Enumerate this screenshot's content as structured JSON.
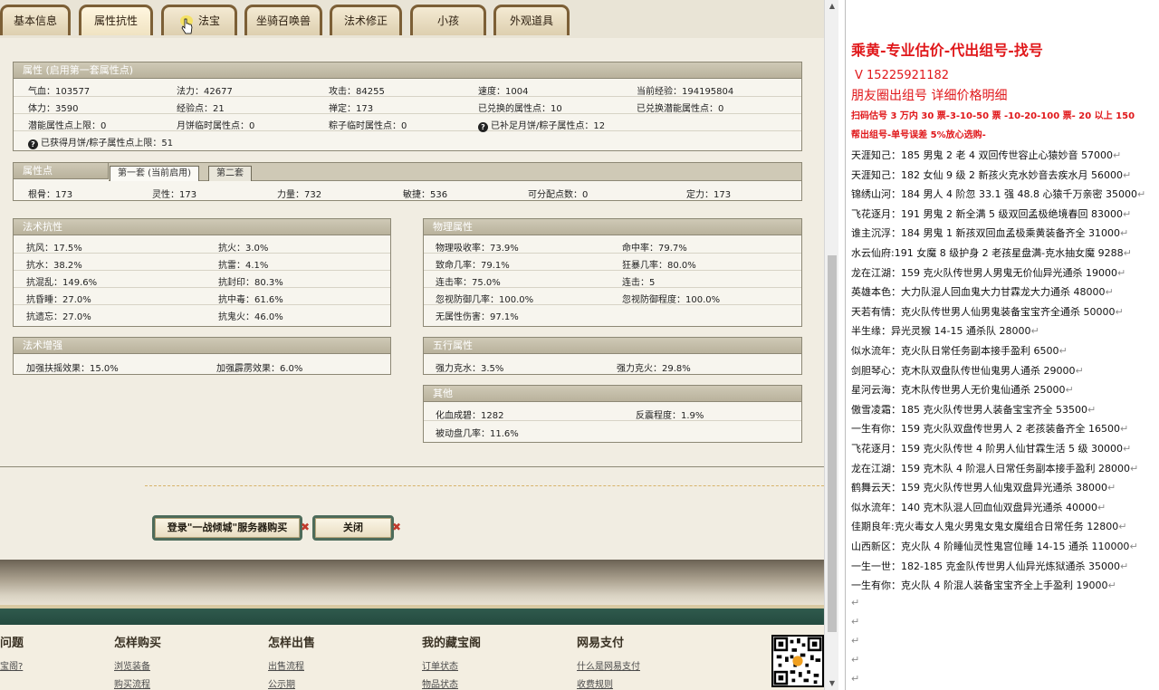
{
  "tabs": [
    "基本信息",
    "属性抗性",
    "法宝",
    "坐骑召唤兽",
    "法术修正",
    "小孩",
    "外观道具"
  ],
  "attr_panel": {
    "title": "属性 (启用第一套属性点)",
    "rows": [
      [
        "气血：103577",
        "法力：42677",
        "攻击：84255",
        "速度：1004",
        "当前经验：194195804"
      ],
      [
        "体力：3590",
        "经验点：21",
        "禅定：173",
        "已兑换的属性点：10",
        "已兑换潜能属性点：0"
      ],
      [
        "潜能属性点上限：0",
        "月饼临时属性点：0",
        "粽子临时属性点：0",
        "已补足月饼/粽子属性点：12",
        ""
      ]
    ],
    "extra": "已获得月饼/粽子属性点上限：51"
  },
  "points_panel": {
    "title": "属性点",
    "subtabs": [
      "第一套 (当前启用)",
      "第二套"
    ],
    "values": [
      "根骨：173",
      "灵性：173",
      "力量：732",
      "敏捷：536",
      "可分配点数：0",
      "定力：173"
    ]
  },
  "resist_panel": {
    "title": "法术抗性",
    "rows": [
      [
        "抗风：17.5%",
        "抗火：3.0%"
      ],
      [
        "抗水：38.2%",
        "抗雷：4.1%"
      ],
      [
        "抗混乱：149.6%",
        "抗封印：80.3%"
      ],
      [
        "抗昏睡：27.0%",
        "抗中毒：61.6%"
      ],
      [
        "抗遗忘：27.0%",
        "抗鬼火：46.0%"
      ]
    ]
  },
  "physical_panel": {
    "title": "物理属性",
    "rows": [
      [
        "物理吸收率：73.9%",
        "命中率：79.7%"
      ],
      [
        "致命几率：79.1%",
        "狂暴几率：80.0%"
      ],
      [
        "连击率：75.0%",
        "连击：5"
      ],
      [
        "忽视防御几率：100.0%",
        "忽视防御程度：100.0%"
      ],
      [
        "无属性伤害：97.1%",
        ""
      ]
    ]
  },
  "boost_panel": {
    "title": "法术增强",
    "row": [
      "加强扶摇效果：15.0%",
      "加强霹雳效果：6.0%"
    ]
  },
  "five_panel": {
    "title": "五行属性",
    "row": [
      "强力克水：3.5%",
      "强力克火：29.8%"
    ]
  },
  "other_panel": {
    "title": "其他",
    "rows": [
      [
        "化血成碧：1282",
        "反震程度：1.9%"
      ],
      [
        "被动盘几率：11.6%",
        ""
      ]
    ]
  },
  "buttons": {
    "login": "登录\"一战倾城\"服务器购买",
    "close": "关闭",
    "x": "✖"
  },
  "footer": {
    "cols": [
      {
        "title": "问题",
        "links": [
          "宝阁?",
          ""
        ]
      },
      {
        "title": "怎样购买",
        "links": [
          "浏览装备",
          "购买流程"
        ]
      },
      {
        "title": "怎样出售",
        "links": [
          "出售流程",
          "公示期"
        ]
      },
      {
        "title": "我的藏宝阁",
        "links": [
          "订单状态",
          "物品状态"
        ]
      },
      {
        "title": "网易支付",
        "links": [
          "什么是网易支付",
          "收费规则"
        ]
      }
    ]
  },
  "doc": {
    "header1": "乘黄-专业估价-代出组号-找号",
    "header2": "V 15225921182",
    "header3": "朋友圈出组号    详细价格明细",
    "header4": "扫码估号 3 万内 30 票-3-10-50 票  -10-20-100 票- 20 以上 150",
    "header5": "帮出组号-单号误差 5%放心选购-",
    "lines": [
      "天涯知己：185 男鬼 2 老 4 双回传世容止心猿妙音 57000",
      "天涯知己：182 女仙 9 级 2 新孩火克水妙音去疾水月 56000",
      "锦绣山河：184 男人 4 阶忽 33.1 强 48.8 心猿千万亲密 35000",
      "飞花逐月：191 男鬼 2 新全满 5 级双回孟极绝境春回 83000",
      "谁主沉浮：184 男鬼 1 新孩双回血孟极乘黄装备齐全 31000",
      "水云仙府:191 女魔 8 级护身 2 老孩星盘满-克水抽女魔 9288",
      "龙在江湖：159 克火队传世男人男鬼无价仙异光通杀 19000",
      "英雄本色：大力队混人回血鬼大力甘霖龙大力通杀 48000",
      "天若有情：克火队传世男人仙男鬼装备宝宝齐全通杀 50000",
      "半生缘：异光灵猴 14-15 通杀队 28000",
      "似水流年：克火队日常任务副本接手盈利 6500",
      "剑胆琴心：克木队双盘队传世仙鬼男人通杀 29000",
      "星河云海：克木队传世男人无价鬼仙通杀 25000",
      "傲雪凌霜：185 克火队传世男人装备宝宝齐全 53500",
      "一生有你：159 克火队双盘传世男人 2 老孩装备齐全 16500",
      "飞花逐月：159 克火队传世 4 阶男人仙甘霖生活 5 级 30000",
      "龙在江湖：159 克木队 4 阶混人日常任务副本接手盈利 28000",
      "鹤舞云天：159 克火队传世男人仙鬼双盘异光通杀 38000",
      "似水流年：140 克木队混人回血仙双盘异光通杀 40000",
      "佳期良年:克火毒女人鬼火男鬼女鬼女魔组合日常任务 12800",
      "山西新区：克火队 4 阶睡仙灵性鬼宫位睡 14-15 通杀 110000",
      "一生一世：182-185 克金队传世男人仙异光炼狱通杀 35000",
      "一生有你：克火队 4 阶混人装备宝宝齐全上手盈利 19000"
    ],
    "para_mark": "↵"
  }
}
